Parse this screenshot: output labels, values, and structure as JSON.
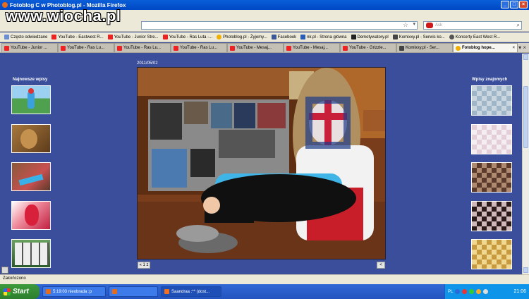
{
  "watermark": "www.wiocha.pl",
  "window": {
    "title": "Fotoblog C                w Photoblog.pl - Mozilla Firefox"
  },
  "search": {
    "placeholder": "Ask"
  },
  "bookmarks": [
    {
      "label": "Często odwiedzane",
      "icon": "often"
    },
    {
      "label": "YouTube - Eastwest R...",
      "icon": "yt"
    },
    {
      "label": "YouTube - Junior Stre...",
      "icon": "yt"
    },
    {
      "label": "YouTube - Ras Luta -...",
      "icon": "yt"
    },
    {
      "label": "Photoblog.pl - Żyjemy...",
      "icon": "pb"
    },
    {
      "label": "Facebook",
      "icon": "fb"
    },
    {
      "label": "nk.pl - Strona główna",
      "icon": "nk"
    },
    {
      "label": "Demotywatory.pl",
      "icon": "dm"
    },
    {
      "label": "Komixxy.pl - Serwis ko...",
      "icon": "kb"
    },
    {
      "label": "Koncerty East West R...",
      "icon": "kc"
    }
  ],
  "tabs": [
    {
      "label": "YouTube - Junior ...",
      "icon": "yt",
      "active": false
    },
    {
      "label": "YouTube - Ras Lu...",
      "icon": "yt",
      "active": false
    },
    {
      "label": "YouTube - Ras Lu...",
      "icon": "yt",
      "active": false
    },
    {
      "label": "YouTube - Ras Lu...",
      "icon": "yt",
      "active": false
    },
    {
      "label": "YouTube - Mesaj...",
      "icon": "yt",
      "active": false
    },
    {
      "label": "YouTube - Mesaj...",
      "icon": "yt",
      "active": false
    },
    {
      "label": "YouTube - Grizzle...",
      "icon": "yt",
      "active": false
    },
    {
      "label": "Komixxy.pl - Ser...",
      "icon": "kb",
      "active": false
    },
    {
      "label": "Fotoblog hope...",
      "icon": "pb",
      "active": true
    }
  ],
  "blog": {
    "left_title": "Najnowsze wpisy",
    "right_title": "Wpisy znajomych",
    "date": "2011/05/02",
    "prev_label": "« 1 z",
    "share_label": "<"
  },
  "status": {
    "text": "Zakończono"
  },
  "taskbar": {
    "start_label": "Start",
    "items": [
      {
        "label": "5:19:03 nieobrada :p",
        "pressed": false
      },
      {
        "label": "",
        "pressed": false
      },
      {
        "label": "Saandraa   :** (dost...",
        "pressed": true
      }
    ],
    "lang": "PL",
    "clock": "21:06"
  }
}
